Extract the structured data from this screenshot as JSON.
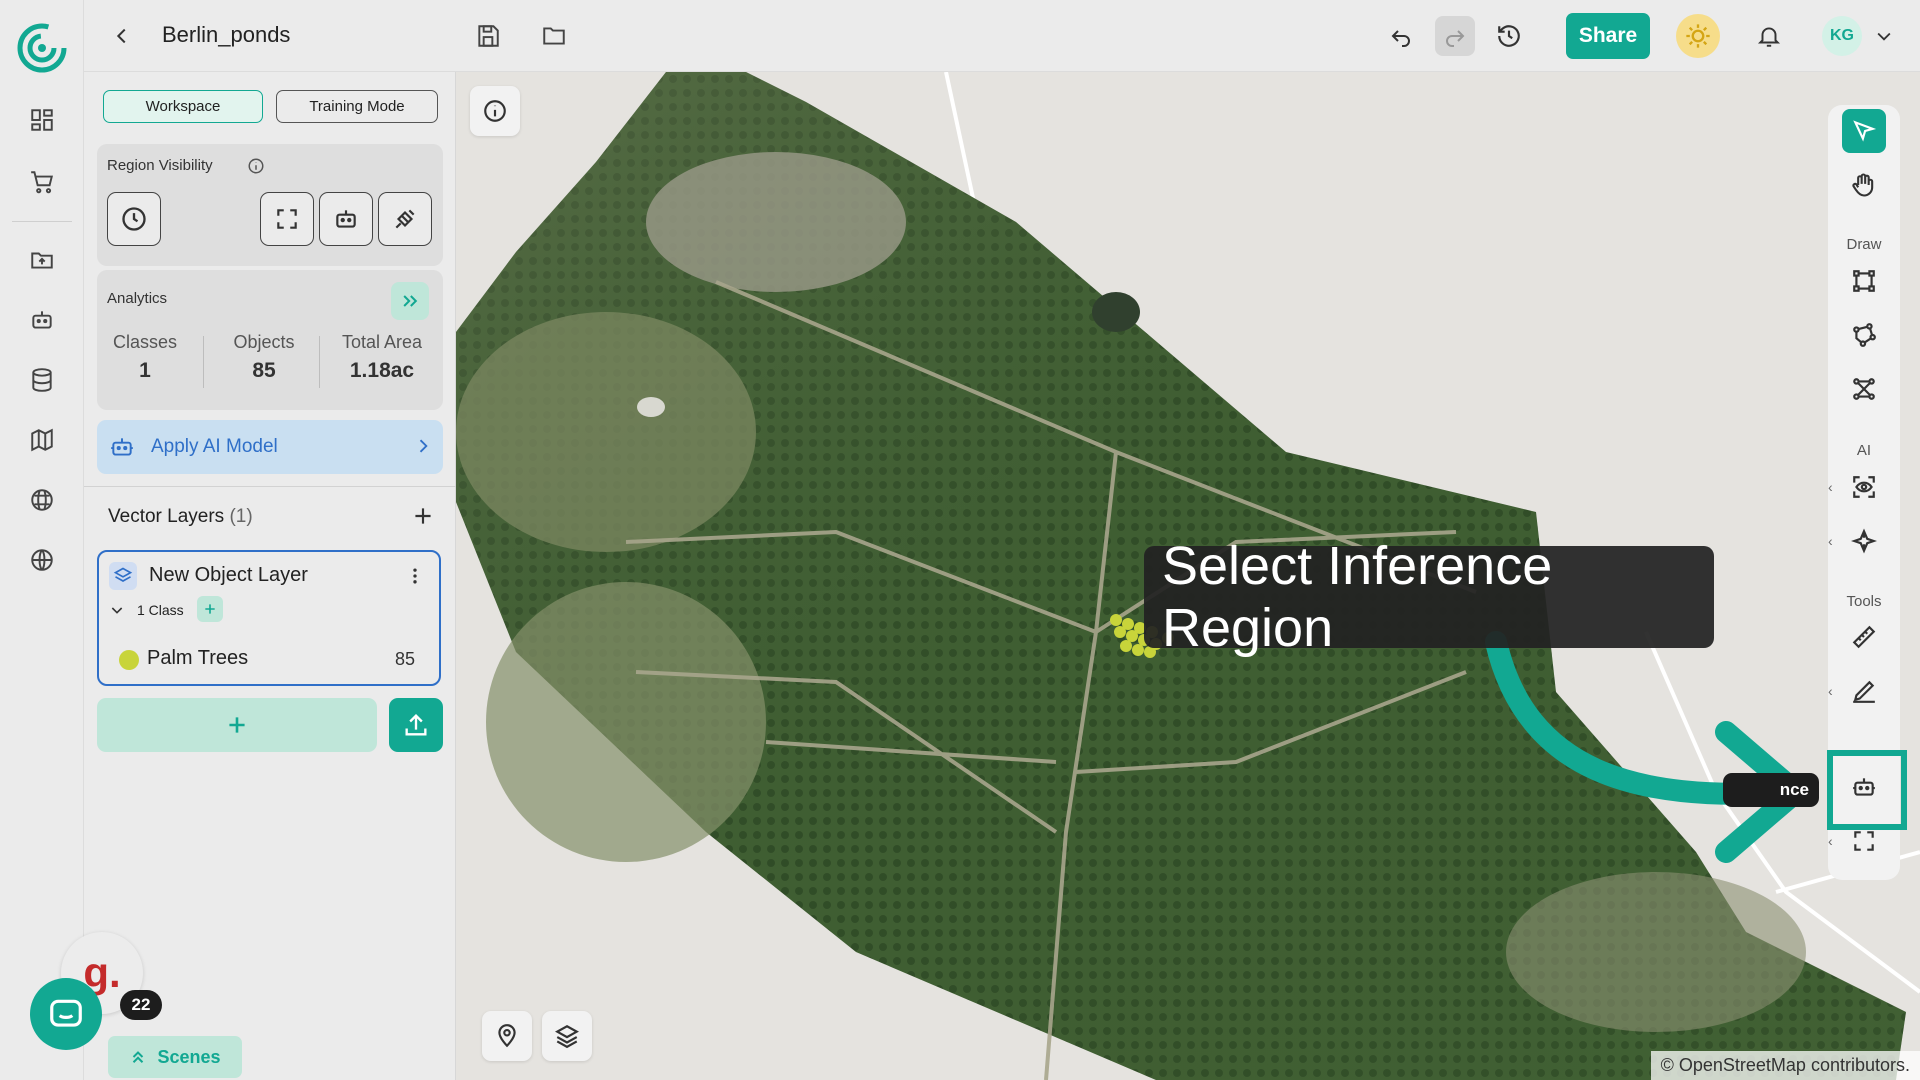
{
  "header": {
    "project_title": "Berlin_ponds",
    "share_label": "Share",
    "user_initials": "KG"
  },
  "panel": {
    "modes": [
      "Workspace",
      "Training Mode"
    ],
    "region_visibility_label": "Region Visibility",
    "analytics": {
      "title": "Analytics",
      "stats": [
        {
          "label": "Classes",
          "value": "1"
        },
        {
          "label": "Objects",
          "value": "85"
        },
        {
          "label": "Total Area",
          "value": "1.18ac"
        }
      ]
    },
    "apply_ai_label": "Apply AI Model",
    "vector_layers": {
      "title": "Vector Layers",
      "count": "(1)"
    },
    "layer": {
      "name": "New Object Layer",
      "classes_label": "1 Class",
      "class_item": {
        "name": "Palm Trees",
        "count": "85",
        "color": "#c8d43a"
      }
    }
  },
  "toolbar": {
    "sections": {
      "draw": "Draw",
      "ai": "AI",
      "tools": "Tools"
    },
    "small_tooltip": "nce"
  },
  "map": {
    "tooltip": "Select Inference Region",
    "attribution": "© OpenStreetMap contributors."
  },
  "chat": {
    "badge_letter": "g.",
    "unread_count": "22"
  },
  "scenes_label": "Scenes",
  "colors": {
    "accent": "#12a892",
    "highlight_box": "#12a892",
    "layer_border": "#2f6fc8",
    "palm_trees": "#c8d43a"
  }
}
